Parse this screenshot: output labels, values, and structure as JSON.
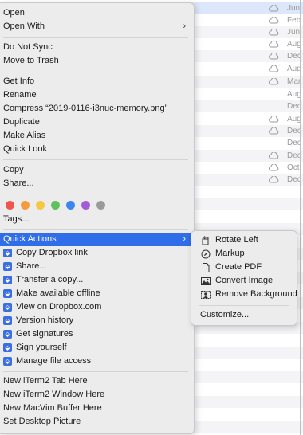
{
  "background_dates": [
    "Jun",
    "Feb",
    "Jun",
    "Aug",
    "Dec",
    "Aug",
    "Mar",
    "Aug",
    "Dec",
    "Aug",
    "Dec",
    "Dec",
    "Dec",
    "Oct",
    "Dec"
  ],
  "menu": {
    "items": [
      {
        "label": "Open"
      },
      {
        "label": "Open With",
        "submenu": true
      },
      {
        "label": "Do Not Sync"
      },
      {
        "label": "Move to Trash"
      },
      {
        "label": "Get Info"
      },
      {
        "label": "Rename"
      },
      {
        "label": "Compress “2019-0116-i3nuc-memory.png”"
      },
      {
        "label": "Duplicate"
      },
      {
        "label": "Make Alias"
      },
      {
        "label": "Quick Look"
      },
      {
        "label": "Copy"
      },
      {
        "label": "Share..."
      },
      {
        "label": "Tags..."
      },
      {
        "label": "Quick Actions",
        "submenu": true
      },
      {
        "label": "Copy Dropbox link"
      },
      {
        "label": "Share..."
      },
      {
        "label": "Transfer a copy..."
      },
      {
        "label": "Make available offline"
      },
      {
        "label": "View on Dropbox.com"
      },
      {
        "label": "Version history"
      },
      {
        "label": "Get signatures"
      },
      {
        "label": "Sign yourself"
      },
      {
        "label": "Manage file access"
      },
      {
        "label": "New iTerm2 Tab Here"
      },
      {
        "label": "New iTerm2 Window Here"
      },
      {
        "label": "New MacVim Buffer Here"
      },
      {
        "label": "Set Desktop Picture"
      }
    ],
    "tag_colors": [
      "#f0564d",
      "#f59b3b",
      "#f5c842",
      "#5ec25a",
      "#3d86f0",
      "#a45bd6",
      "#9a9a9a"
    ],
    "submenu_arrow": "›",
    "dropbox_icon": "⬙"
  },
  "quick_actions": {
    "items": [
      {
        "label": "Rotate Left",
        "icon": "rotate-left-icon"
      },
      {
        "label": "Markup",
        "icon": "markup-icon"
      },
      {
        "label": "Create PDF",
        "icon": "pdf-document-icon"
      },
      {
        "label": "Convert Image",
        "icon": "convert-image-icon"
      },
      {
        "label": "Remove Background",
        "icon": "remove-background-icon"
      },
      {
        "label": "Customize..."
      }
    ]
  },
  "accent": "#2f6ee8"
}
